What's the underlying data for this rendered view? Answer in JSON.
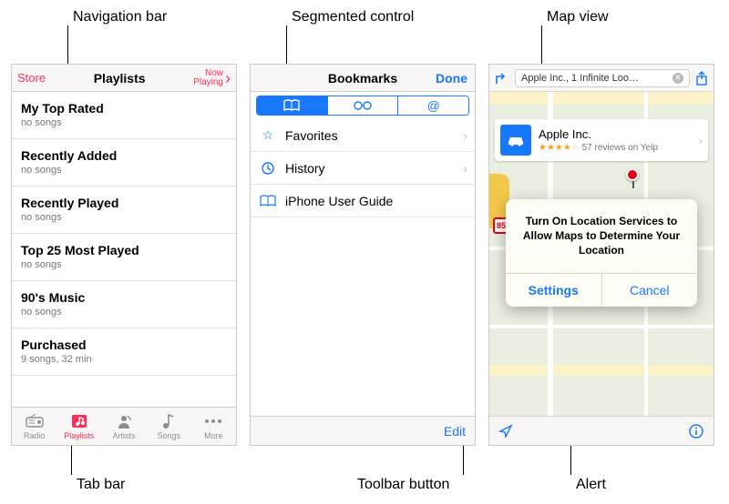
{
  "annotations": {
    "navbar": "Navigation bar",
    "segmented": "Segmented control",
    "mapview": "Map view",
    "tabbar": "Tab bar",
    "toolbarbtn": "Toolbar button",
    "alert": "Alert"
  },
  "s1": {
    "store": "Store",
    "title": "Playlists",
    "now": "Now",
    "playing": "Playing",
    "rows": [
      {
        "t": "My Top Rated",
        "s": "no songs"
      },
      {
        "t": "Recently Added",
        "s": "no songs"
      },
      {
        "t": "Recently Played",
        "s": "no songs"
      },
      {
        "t": "Top 25 Most Played",
        "s": "no songs"
      },
      {
        "t": "90's Music",
        "s": "no songs"
      },
      {
        "t": "Purchased",
        "s": "9 songs, 32 min"
      }
    ],
    "tabs": [
      {
        "label": "Radio"
      },
      {
        "label": "Playlists"
      },
      {
        "label": "Artists"
      },
      {
        "label": "Songs"
      },
      {
        "label": "More"
      }
    ]
  },
  "s2": {
    "title": "Bookmarks",
    "done": "Done",
    "rows": [
      {
        "label": "Favorites"
      },
      {
        "label": "History"
      },
      {
        "label": "iPhone User Guide"
      }
    ],
    "edit": "Edit"
  },
  "s3": {
    "search": "Apple Inc., 1 Infinite Loo…",
    "card": {
      "name": "Apple Inc.",
      "stars": "★★★★",
      "half": "☆",
      "reviews": " 57 reviews on Yelp"
    },
    "route": "85",
    "alert": {
      "msg": "Turn On Location Services to Allow Maps to Determine Your Location",
      "settings": "Settings",
      "cancel": "Cancel"
    }
  }
}
